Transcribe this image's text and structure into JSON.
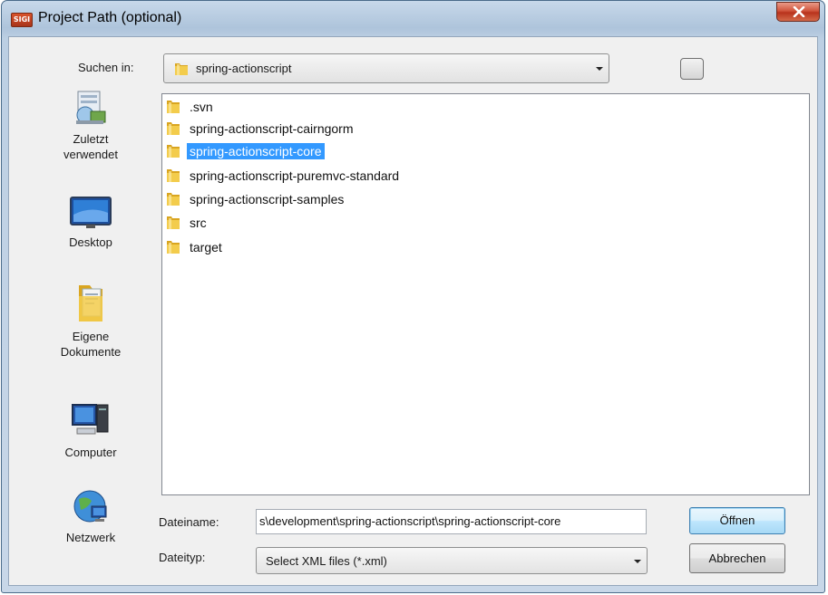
{
  "window": {
    "title": "Project Path (optional)",
    "app_icon_text": "SIGI"
  },
  "lookin": {
    "label": "Suchen in:",
    "value": "spring-actionscript"
  },
  "places": [
    {
      "label_lines": [
        "Zuletzt",
        "verwendet"
      ],
      "icon": "recent-places-icon"
    },
    {
      "label_lines": [
        "Desktop"
      ],
      "icon": "desktop-icon"
    },
    {
      "label_lines": [
        "Eigene",
        "Dokumente"
      ],
      "icon": "documents-folder-icon"
    },
    {
      "label_lines": [
        "Computer"
      ],
      "icon": "computer-icon"
    },
    {
      "label_lines": [
        "Netzwerk"
      ],
      "icon": "network-icon"
    }
  ],
  "files": [
    {
      "name": ".svn",
      "selected": false
    },
    {
      "name": "spring-actionscript-cairngorm",
      "selected": false
    },
    {
      "name": "spring-actionscript-core",
      "selected": true
    },
    {
      "name": "spring-actionscript-puremvc-standard",
      "selected": false
    },
    {
      "name": "spring-actionscript-samples",
      "selected": false
    },
    {
      "name": "src",
      "selected": false
    },
    {
      "name": "target",
      "selected": false
    }
  ],
  "filename": {
    "label": "Dateiname:",
    "value": "s\\development\\spring-actionscript\\spring-actionscript-core"
  },
  "filetype": {
    "label": "Dateityp:",
    "value": "Select XML files (*.xml)"
  },
  "buttons": {
    "open": "Öffnen",
    "cancel": "Abbrechen"
  },
  "colors": {
    "selection": "#3399ff",
    "folder": "#e8b830",
    "close_button": "#c9452b"
  }
}
